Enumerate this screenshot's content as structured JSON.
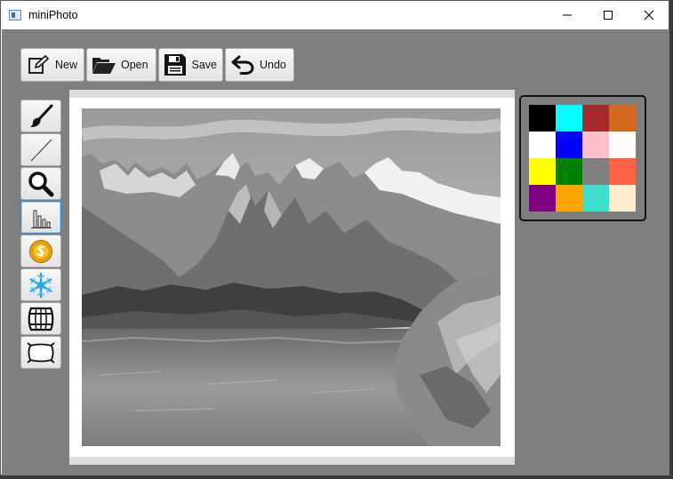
{
  "window": {
    "title": "miniPhoto"
  },
  "toolbar": {
    "buttons": [
      {
        "label": "New",
        "icon": "edit-icon"
      },
      {
        "label": "Open",
        "icon": "folder-open-icon"
      },
      {
        "label": "Save",
        "icon": "floppy-disk-icon"
      },
      {
        "label": "Undo",
        "icon": "undo-arrow-icon"
      }
    ]
  },
  "tools": [
    {
      "name": "brush",
      "icon": "brush-icon",
      "selected": false
    },
    {
      "name": "line",
      "icon": "line-icon",
      "selected": false
    },
    {
      "name": "zoom",
      "icon": "magnifier-icon",
      "selected": false
    },
    {
      "name": "histogram",
      "icon": "histogram-icon",
      "selected": true
    },
    {
      "name": "coin",
      "icon": "coin-icon",
      "selected": false
    },
    {
      "name": "snowflake",
      "icon": "snowflake-icon",
      "selected": false
    },
    {
      "name": "barrel",
      "icon": "barrel-icon",
      "selected": false
    },
    {
      "name": "frame",
      "icon": "frame-icon",
      "selected": false
    }
  ],
  "canvas": {
    "image": "grayscale mountain lake photo"
  },
  "palette": {
    "colors": [
      "#000000",
      "#00ffff",
      "#a52a2a",
      "#d2691e",
      "#ffffff",
      "#0000ff",
      "#ffc0cb",
      "#fffafa",
      "#ffff00",
      "#008000",
      "#808080",
      "#ff6347",
      "#800080",
      "#ffa500",
      "#40e0d0",
      "#ffebcd"
    ]
  }
}
